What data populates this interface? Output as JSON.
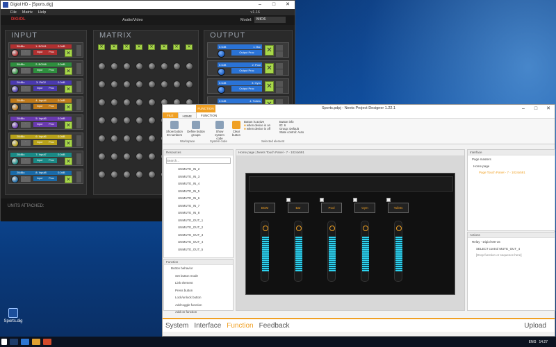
{
  "digiol": {
    "title": "Digiol HD - [Sports.dig]",
    "menu": [
      "File",
      "Matrix",
      "Help"
    ],
    "version": "v1.16",
    "logo": "DIGIOL",
    "audio_video": "Audio/Video",
    "model_label": "Model:",
    "model_value": "MIO6",
    "sec_input": "INPUT",
    "sec_matrix": "MATRIX",
    "sec_output": "OUTPUT",
    "units_attached": "UNITS ATTACHED:",
    "inputs": [
      {
        "id": "1",
        "name": "BGM1",
        "gain": "30dBu",
        "level": "0.0dB",
        "input": "Input",
        "proc": "Proc",
        "color": "#b03030"
      },
      {
        "id": "2",
        "name": "BGM6",
        "gain": "30dBu",
        "level": "0.0dB",
        "input": "Input",
        "proc": "Proc",
        "color": "#2e8f3e"
      },
      {
        "id": "3",
        "name": "PA02",
        "gain": "20dBu",
        "level": "0.0dB",
        "input": "Input",
        "proc": "Proc",
        "color": "#4a3ab0"
      },
      {
        "id": "4",
        "name": "Input4",
        "gain": "20dBu",
        "level": "0.0dB",
        "input": "Input",
        "proc": "Proc",
        "color": "#c07a1a"
      },
      {
        "id": "5",
        "name": "Input5",
        "gain": "20dBu",
        "level": "0.0dB",
        "input": "Input",
        "proc": "Proc",
        "color": "#6a3ab0"
      },
      {
        "id": "6",
        "name": "Input6",
        "gain": "20dBu",
        "level": "0.0dB",
        "input": "Input",
        "proc": "Proc",
        "color": "#b8a21a"
      },
      {
        "id": "7",
        "name": "Input7",
        "gain": "20dBu",
        "level": "0.0dB",
        "input": "Input",
        "proc": "Proc",
        "color": "#1a8a86"
      },
      {
        "id": "8",
        "name": "Input8",
        "gain": "20dBu",
        "level": "0.0dB",
        "input": "Input",
        "proc": "Proc",
        "color": "#1a6aa8"
      }
    ],
    "outputs": [
      {
        "id": "1",
        "name": "Bar",
        "level": "0.0dB",
        "proc": "Output Proc"
      },
      {
        "id": "2",
        "name": "Pool",
        "level": "0.0dB",
        "proc": "Output Proc"
      },
      {
        "id": "3",
        "name": "Gym",
        "level": "0.0dB",
        "proc": "Output Proc"
      },
      {
        "id": "4",
        "name": "Toilets",
        "level": "0.0dB",
        "proc": "Output Proc"
      }
    ]
  },
  "neets": {
    "title": "Sports.pdpj - Neets Project Designer 1.22.1",
    "context_tab": "FUNCTION",
    "tabs": [
      "FILE",
      "HOME",
      "FUNCTION"
    ],
    "ribbon": {
      "show_ids": "Show button ID numbers",
      "define_groups": "Define button groups",
      "show_code": "Show system code",
      "clear": "Clear button",
      "button_active": "Button is active",
      "when_on": "when device is on",
      "when_off": "when device is off",
      "button_info": "Button info",
      "id_label": "ID:",
      "id_value": "6",
      "group_label": "Group:",
      "group_value": "Default",
      "state_label": "State control:",
      "state_value": "Auto",
      "g_workspace": "Workspace",
      "g_system": "System code",
      "g_selected": "Selected element"
    },
    "resources_title": "Resources",
    "search_placeholder": "Search...",
    "resources": [
      "UNMUTE_IN_2",
      "UNMUTE_IN_3",
      "UNMUTE_IN_4",
      "UNMUTE_IN_5",
      "UNMUTE_IN_6",
      "UNMUTE_IN_7",
      "UNMUTE_IN_8",
      "UNMUTE_OUT_1",
      "UNMUTE_OUT_2",
      "UNMUTE_OUT_3",
      "UNMUTE_OUT_4",
      "UNMUTE_OUT_5"
    ],
    "function_title": "Function",
    "functions": [
      "Button behavior",
      "Set button mode",
      "Link element",
      "Press button",
      "Lock/unlock button",
      "Add toggle function",
      "Add on function"
    ],
    "canvas_title": "Home page | Neets Touch Panel - 7 - 1024x591",
    "panel_buttons": [
      "BGM",
      "Bar",
      "Pool",
      "Gym",
      "Toilets"
    ],
    "interface_title": "Interface",
    "page_masters": "Page masters",
    "home_page": "Home page",
    "touch_panel": "Page Touch Panel - 7 - 1024x591",
    "actions_title": "Actions",
    "action_relay": "Relay - Digiol MII-16",
    "action_select": "SELECT control MUTE_OUT_4",
    "action_drop": "[Drop function or sequence here]",
    "nav": [
      "System",
      "Interface",
      "Function",
      "Feedback"
    ],
    "upload": "Upload"
  },
  "taskbar": {
    "lang": "ENG",
    "time": "14:27"
  },
  "desktop_icon": "Sports.dig"
}
